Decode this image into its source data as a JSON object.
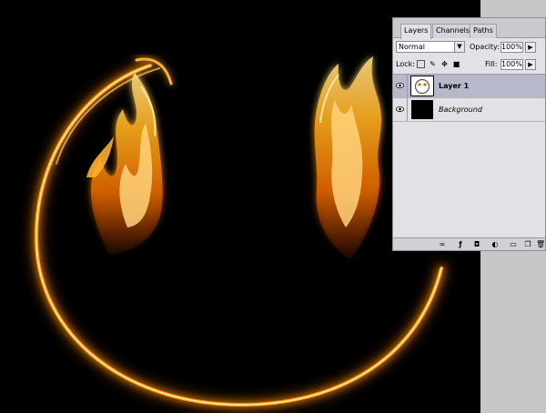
{
  "panel": {
    "tabs": [
      {
        "label": "Layers",
        "active": true
      },
      {
        "label": "Channels",
        "active": false
      },
      {
        "label": "Paths",
        "active": false
      }
    ],
    "blend_mode": "Normal",
    "opacity_label": "Opacity:",
    "opacity_value": "100%",
    "lock_label": "Lock:",
    "fill_label": "Fill:",
    "fill_value": "100%",
    "layers": [
      {
        "name": "Layer 1",
        "selected": true,
        "visible": true,
        "thumb_icon": "smiley-fire-thumbnail"
      },
      {
        "name": "Background",
        "selected": false,
        "visible": true,
        "thumb_icon": "black-fill-thumbnail"
      }
    ],
    "bottom_icons": [
      "link-icon",
      "layer-style-icon",
      "layer-mask-icon",
      "adjustment-layer-icon",
      "new-group-icon",
      "new-layer-icon",
      "delete-layer-icon"
    ]
  },
  "colors": {
    "canvas": "#000000",
    "pasteboard": "#c6c6c6",
    "panel_bg": "#e2e2e6",
    "selected_row": "#b7b8c9",
    "fire_core": "#fff2b0",
    "fire_mid": "#ffb020",
    "fire_edge": "#e86a00"
  }
}
